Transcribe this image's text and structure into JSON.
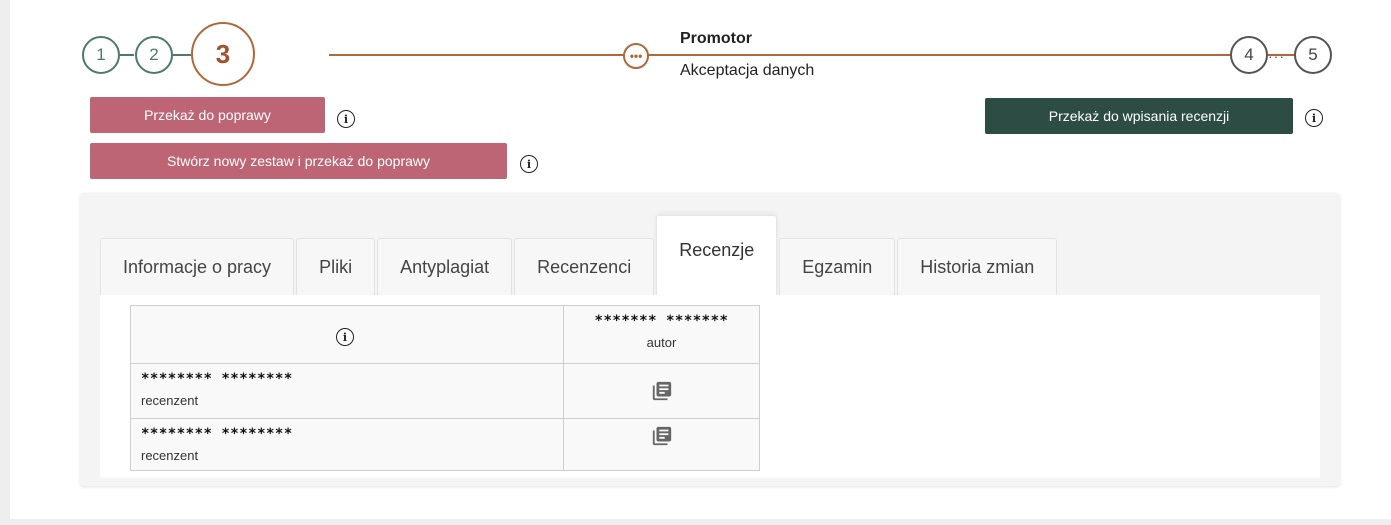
{
  "stepper": {
    "steps": [
      {
        "label": "1",
        "state": "done"
      },
      {
        "label": "2",
        "state": "done"
      },
      {
        "label": "3",
        "state": "current"
      },
      {
        "label": "4",
        "state": "future"
      },
      {
        "label": "5",
        "state": "future"
      }
    ],
    "substep_icon": "ellipsis-circle-icon",
    "substep_title": "Promotor",
    "substep_subtitle": "Akceptacja danych",
    "colors": {
      "done": "#4e7a68",
      "current": "#b0683a",
      "future": "#555555"
    }
  },
  "actions": {
    "return_for_correction": "Przekaż do poprawy",
    "create_new_set_and_return": "Stwórz nowy zestaw i przekaż do poprawy",
    "forward_to_review": "Przekaż do wpisania recenzji",
    "colors": {
      "pink": "#bd6574",
      "green": "#2d4c43"
    }
  },
  "tabs": [
    {
      "label": "Informacje o pracy",
      "active": false
    },
    {
      "label": "Pliki",
      "active": false
    },
    {
      "label": "Antyplagiat",
      "active": false
    },
    {
      "label": "Recenzenci",
      "active": false
    },
    {
      "label": "Recenzje",
      "active": true
    },
    {
      "label": "Egzamin",
      "active": false
    },
    {
      "label": "Historia zmian",
      "active": false
    }
  ],
  "reviews_table": {
    "header_info_icon": "info-icon",
    "author_name": "******* *******",
    "author_role": "autor",
    "rows": [
      {
        "name": "******** ********",
        "role": "recenzent",
        "icon": "document-list-icon"
      },
      {
        "name": "******** ********",
        "role": "recenzent",
        "icon": "document-list-icon"
      }
    ]
  }
}
